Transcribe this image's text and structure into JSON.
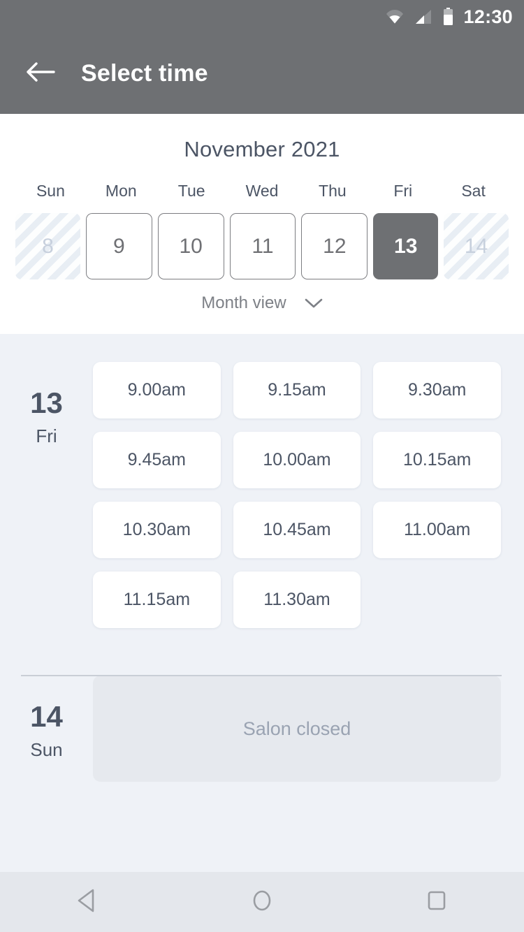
{
  "statusbar": {
    "time": "12:30",
    "icons": [
      "wifi-icon",
      "signal-icon",
      "battery-icon"
    ]
  },
  "appbar": {
    "title": "Select time",
    "back_icon": "arrow-left-icon"
  },
  "calendar": {
    "month_title": "November 2021",
    "day_headers": [
      "Sun",
      "Mon",
      "Tue",
      "Wed",
      "Thu",
      "Fri",
      "Sat"
    ],
    "dates": [
      {
        "num": "8",
        "state": "disabled"
      },
      {
        "num": "9",
        "state": "enabled"
      },
      {
        "num": "10",
        "state": "enabled"
      },
      {
        "num": "11",
        "state": "enabled"
      },
      {
        "num": "12",
        "state": "enabled"
      },
      {
        "num": "13",
        "state": "selected"
      },
      {
        "num": "14",
        "state": "disabled"
      }
    ],
    "view_toggle_label": "Month view",
    "view_toggle_icon": "chevron-down-icon"
  },
  "days": [
    {
      "day_num": "13",
      "day_dow": "Fri",
      "slots": [
        "9.00am",
        "9.15am",
        "9.30am",
        "9.45am",
        "10.00am",
        "10.15am",
        "10.30am",
        "10.45am",
        "11.00am",
        "11.15am",
        "11.30am"
      ]
    },
    {
      "day_num": "14",
      "day_dow": "Sun",
      "closed_label": "Salon closed"
    }
  ],
  "navbar": {
    "back_label": "back-triangle-icon",
    "home_label": "home-circle-icon",
    "recents_label": "recents-square-icon"
  },
  "colors": {
    "chrome": "#6e7073",
    "body_bg": "#eff2f7",
    "card_bg": "#ffffff",
    "text_dark": "#4c5565",
    "text_muted": "#9aa3b2",
    "closed_bg": "#e6e9ee",
    "navbar_bg": "#e4e7ec"
  }
}
